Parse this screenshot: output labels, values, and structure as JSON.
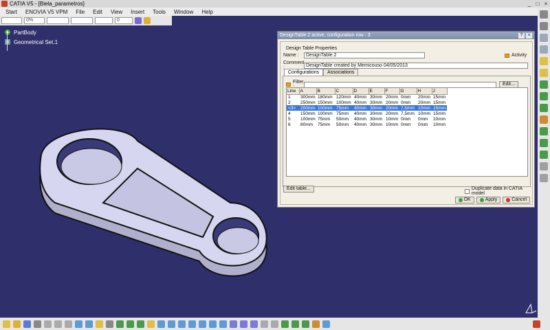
{
  "window": {
    "title": "CATIA V5 - [Biela_parametros]"
  },
  "menu": [
    "Start",
    "ENOVIA V5 VPM",
    "File",
    "Edit",
    "View",
    "Insert",
    "Tools",
    "Window",
    "Help"
  ],
  "top_toolbar": {
    "color_value": "",
    "transparency_value": "0%",
    "line_type": "",
    "line_weight": "",
    "layer_value": "0"
  },
  "tree": {
    "items": [
      "PartBody",
      "Geometrical Set.1"
    ]
  },
  "dialog": {
    "title": "DesignTable.2 active, configuration row : 3",
    "group_label": "Design Table Properties",
    "name_label": "Name :",
    "name_value": "DesignTable.2",
    "comment_label": "Comment :",
    "comment_value": "DesignTable created by Memicouso 04/05/2013",
    "activity_label": "Activity",
    "tabs": [
      "Configurations",
      "Associations"
    ],
    "filter_label": "Filter :",
    "filter_value": "",
    "edit_button": "Edit...",
    "columns": [
      "Line",
      "A",
      "B",
      "C",
      "D",
      "E",
      "F",
      "G",
      "H",
      "J"
    ],
    "rows": [
      [
        "1",
        "300mm",
        "180mm",
        "120mm",
        "40mm",
        "30mm",
        "20mm",
        "0mm",
        "20mm",
        "15mm"
      ],
      [
        "2",
        "250mm",
        "150mm",
        "100mm",
        "40mm",
        "30mm",
        "20mm",
        "0mm",
        "20mm",
        "15mm"
      ],
      [
        "<3>",
        "200mm",
        "100mm",
        "75mm",
        "40mm",
        "30mm",
        "20mm",
        "7,5mm",
        "10mm",
        "15mm"
      ],
      [
        "4",
        "150mm",
        "100mm",
        "75mm",
        "40mm",
        "30mm",
        "20mm",
        "7,5mm",
        "10mm",
        "15mm"
      ],
      [
        "5",
        "100mm",
        "75mm",
        "50mm",
        "40mm",
        "30mm",
        "10mm",
        "0mm",
        "0mm",
        "10mm"
      ],
      [
        "6",
        "80mm",
        "75mm",
        "50mm",
        "40mm",
        "30mm",
        "10mm",
        "0mm",
        "0mm",
        "10mm"
      ]
    ],
    "selected_row": 2,
    "edit_table_button": "Edit table...",
    "duplicate_label": "Duplicate data in CATIA model",
    "ok_label": "OK",
    "apply_label": "Apply",
    "cancel_label": "Cancel"
  },
  "colors": {
    "background": "#2f2f6b",
    "part_fill": "#d6d6f0",
    "selection": "#3b78d8"
  }
}
